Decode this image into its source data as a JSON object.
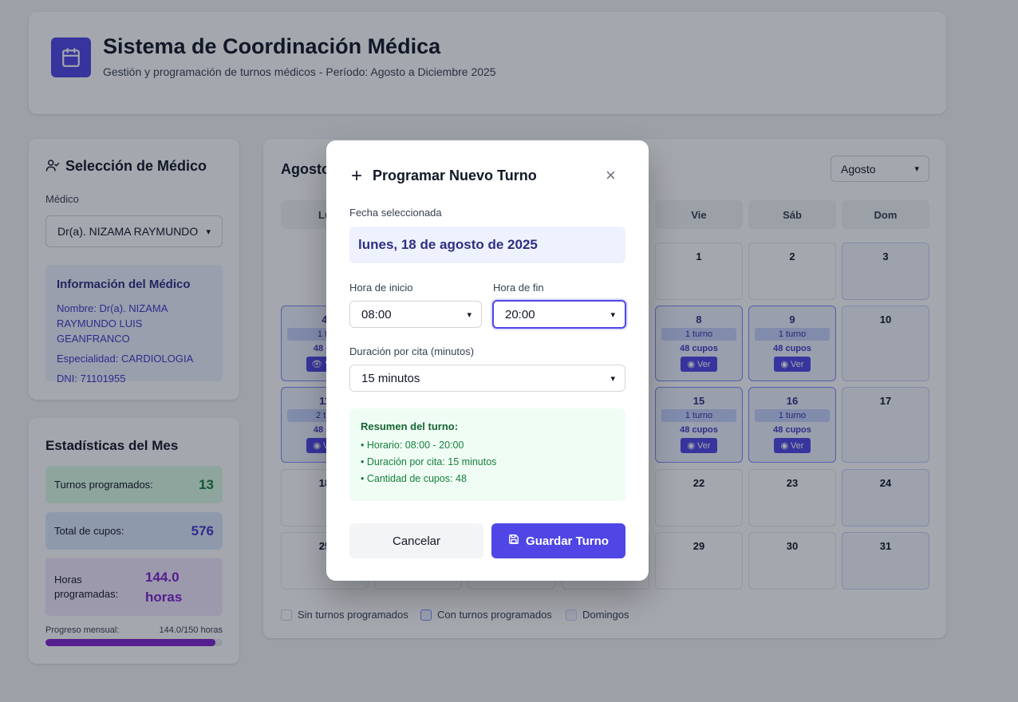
{
  "header": {
    "title": "Sistema de Coordinación Médica",
    "subtitle": "Gestión y programación de turnos médicos - Período: Agosto a Diciembre 2025",
    "logo_icon": "calendar-icon"
  },
  "doctor_panel": {
    "title": "Selección de Médico",
    "field_label": "Médico",
    "selected_doctor": "Dr(a). NIZAMA RAYMUNDO LUIS GEANFRANCO",
    "info": {
      "title": "Información del Médico",
      "name": "Nombre: Dr(a). NIZAMA RAYMUNDO LUIS GEANFRANCO",
      "specialty": "Especialidad: CARDIOLOGIA",
      "dni": "DNI: 71101955"
    }
  },
  "stats": {
    "title": "Estadísticas del Mes",
    "turnos_label": "Turnos programados:",
    "turnos_value": "13",
    "cupos_label": "Total de cupos:",
    "cupos_value": "576",
    "horas_label": "Horas programadas:",
    "horas_value": "144.0 horas",
    "progress_label": "Progreso mensual:",
    "progress_text": "144.0/150 horas",
    "progress_fraction": 0.96,
    "colors": {
      "green": "#15803d",
      "blue": "#4338ca",
      "purple": "#7e22ce"
    }
  },
  "calendar": {
    "title": "Agosto",
    "month_select": "Agosto",
    "weekdays": [
      "Lu",
      "Vie",
      "Sáb",
      "Dom"
    ],
    "ver_label": "Ver",
    "days": [
      {
        "num": "1"
      },
      {
        "num": "2"
      },
      {
        "num": "3"
      },
      {
        "num": "4",
        "turnos": "1 tu",
        "cupos": "48 cu"
      },
      {
        "num": "8",
        "turnos": "1 turno",
        "cupos": "48 cupos"
      },
      {
        "num": "9",
        "turnos": "1 turno",
        "cupos": "48 cupos"
      },
      {
        "num": "10"
      },
      {
        "num": "11",
        "turnos": "2 tur",
        "cupos": "48 cu"
      },
      {
        "num": "15",
        "turnos": "1 turno",
        "cupos": "48 cupos"
      },
      {
        "num": "16",
        "turnos": "1 turno",
        "cupos": "48 cupos"
      },
      {
        "num": "17"
      },
      {
        "num": "18"
      },
      {
        "num": "22"
      },
      {
        "num": "23"
      },
      {
        "num": "24"
      },
      {
        "num": "25"
      },
      {
        "num": "29"
      },
      {
        "num": "30"
      },
      {
        "num": "31"
      }
    ],
    "legend": [
      "Sin turnos programados",
      "Con turnos programados",
      "Domingos"
    ]
  },
  "modal": {
    "title": "Programar Nuevo Turno",
    "date_label": "Fecha seleccionada",
    "date_value": "lunes, 18 de agosto de 2025",
    "start_label": "Hora de inicio",
    "start_value": "08:00",
    "end_label": "Hora de fin",
    "end_value": "20:00",
    "duration_label": "Duración por cita (minutos)",
    "duration_value": "15 minutos",
    "summary_title": "Resumen del turno:",
    "summary_lines": [
      "• Horario: 08:00 - 20:00",
      "• Duración por cita: 15 minutos",
      "• Cantidad de cupos: 48"
    ],
    "cancel_label": "Cancelar",
    "save_label": "Guardar Turno"
  }
}
